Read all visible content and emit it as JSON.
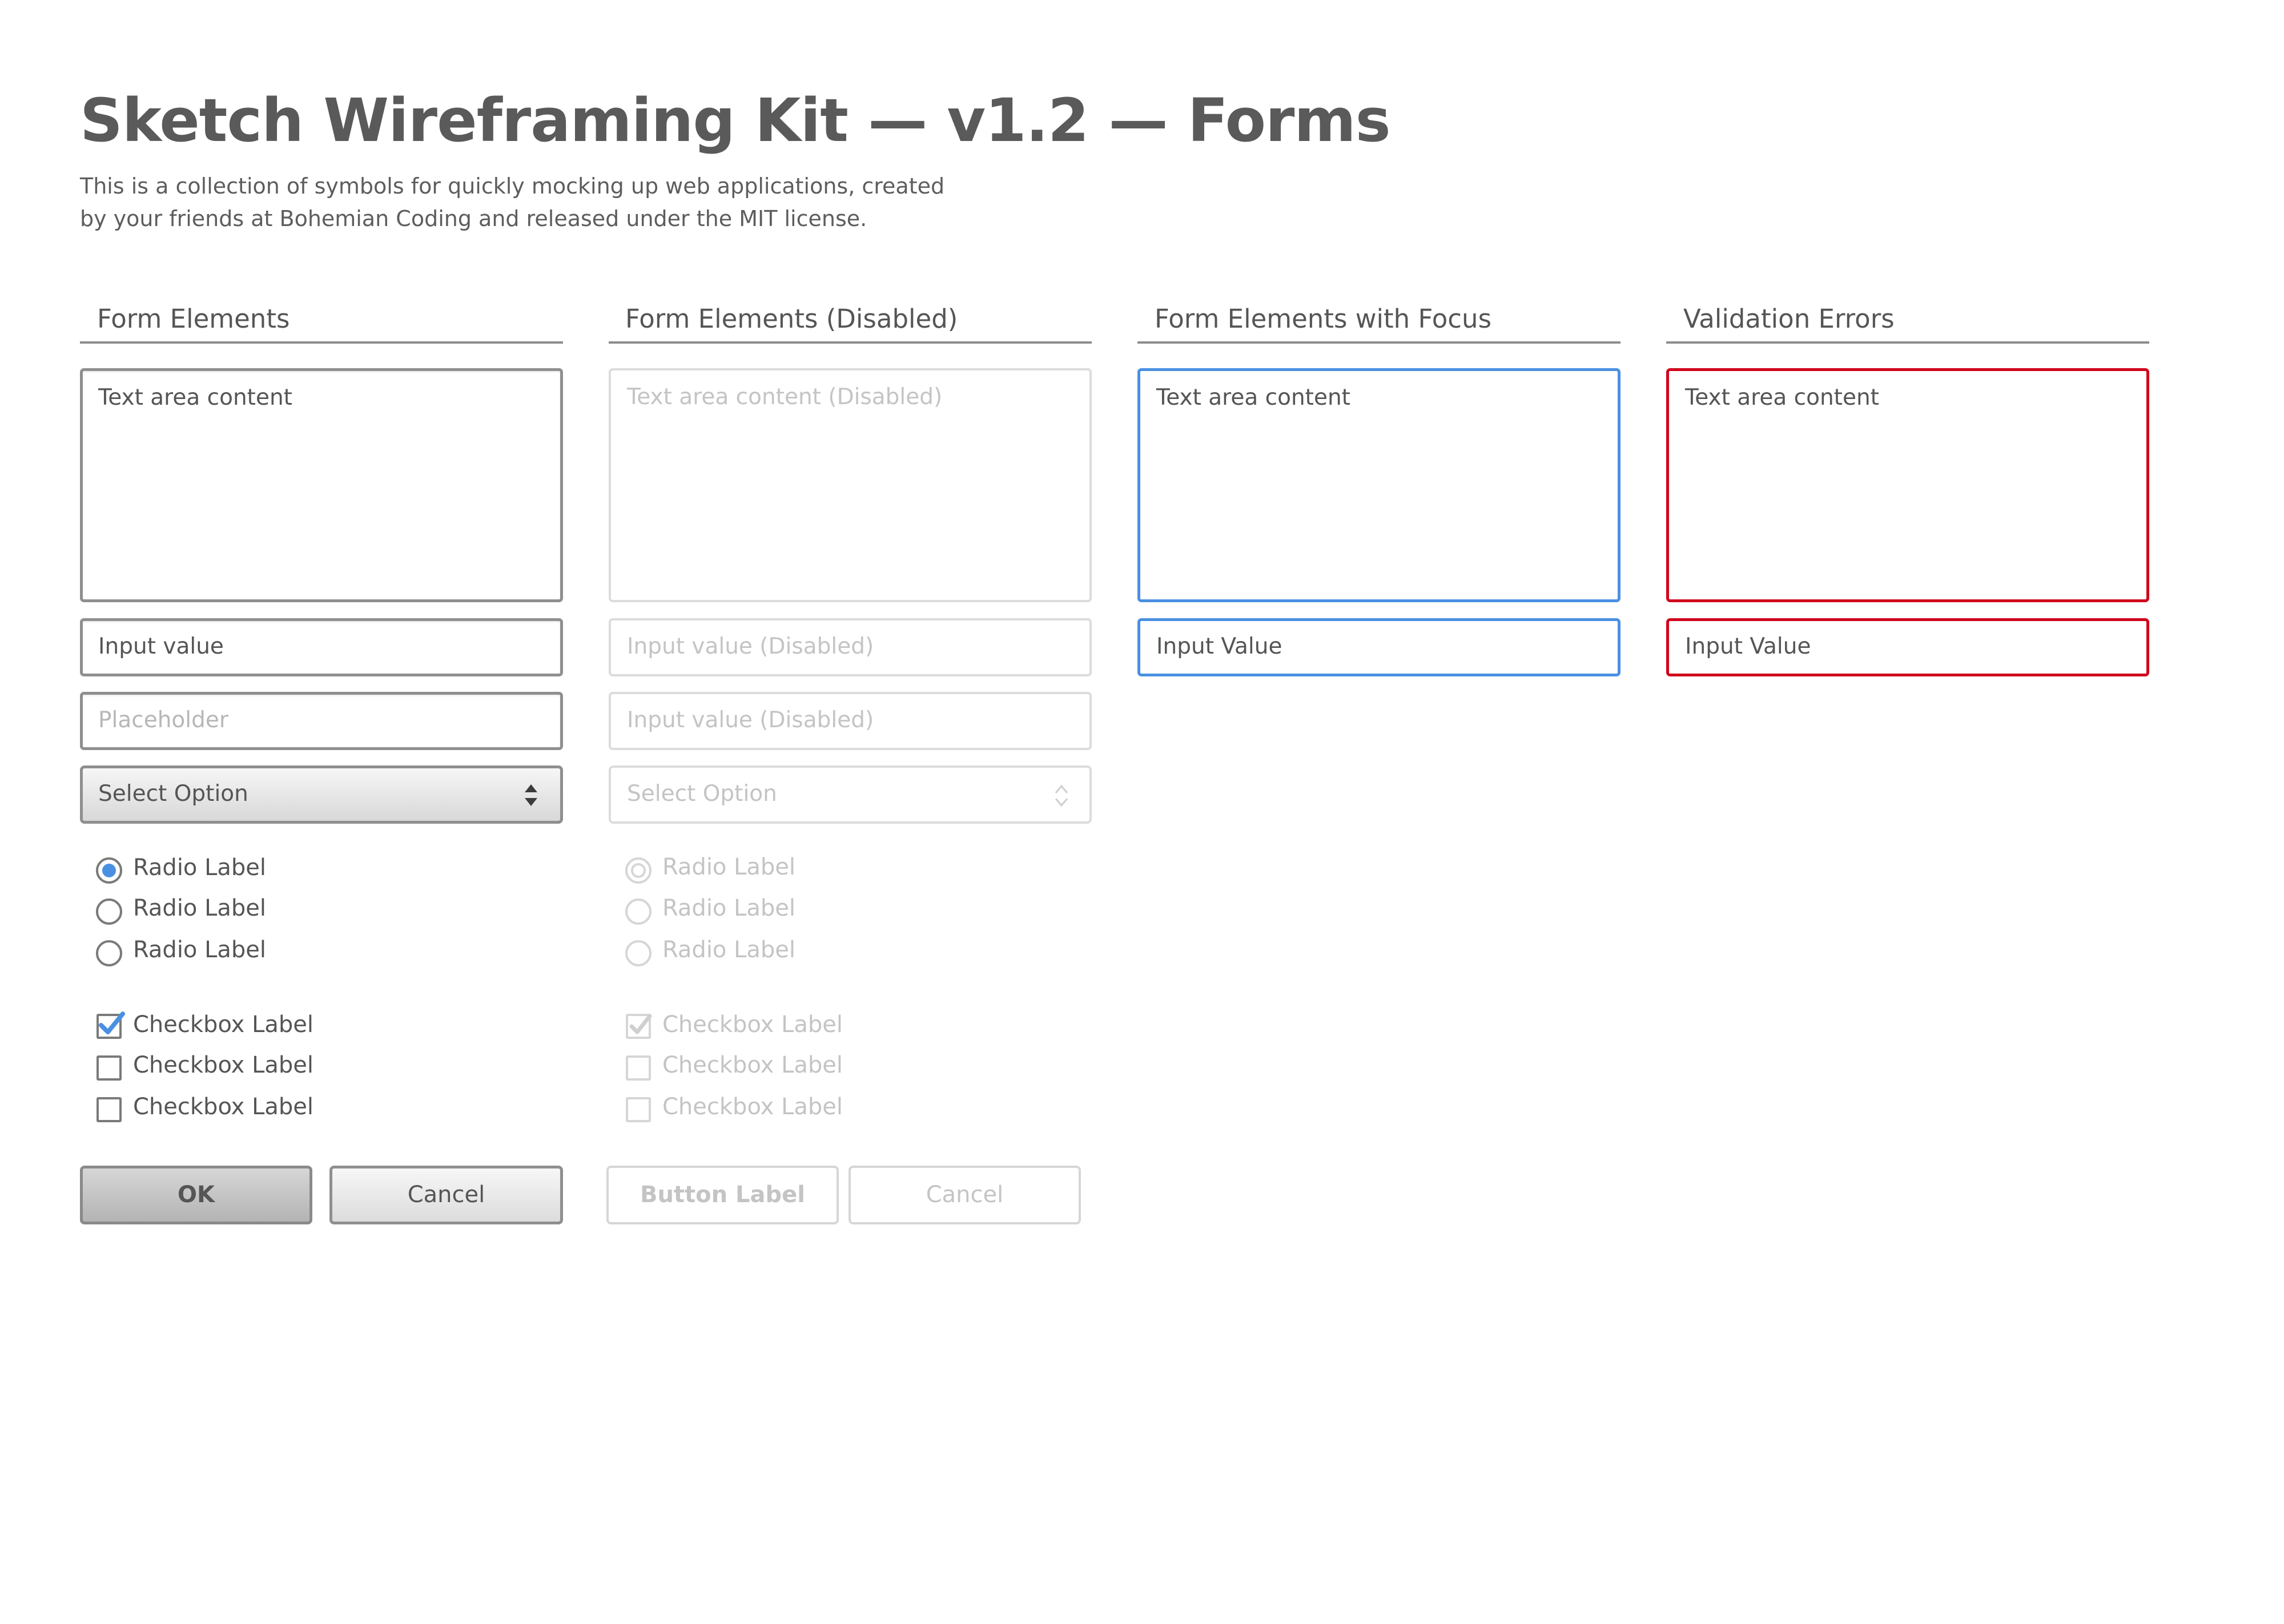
{
  "page": {
    "title": "Sketch Wireframing Kit — v1.2 — Forms",
    "description": "This is a collection of symbols for quickly mocking up web applications, created by your friends at Bohemian Coding and released under the MIT license."
  },
  "colors": {
    "text": "#555555",
    "border": "#8f8f8f",
    "disabled": "#c4c4c4",
    "focus": "#4a90e2",
    "error": "#d0021b"
  },
  "sections": {
    "normal": {
      "title": "Form Elements",
      "textarea": "Text area content",
      "input_value": "Input value",
      "input_placeholder": "Placeholder",
      "select_value": "Select Option",
      "radios": [
        {
          "label": "Radio Label",
          "checked": true
        },
        {
          "label": "Radio Label",
          "checked": false
        },
        {
          "label": "Radio Label",
          "checked": false
        }
      ],
      "checkboxes": [
        {
          "label": "Checkbox Label",
          "checked": true
        },
        {
          "label": "Checkbox Label",
          "checked": false
        },
        {
          "label": "Checkbox Label",
          "checked": false
        }
      ],
      "buttons": {
        "ok": "OK",
        "cancel": "Cancel"
      }
    },
    "disabled": {
      "title": "Form Elements (Disabled)",
      "textarea": "Text area content (Disabled)",
      "input_value_1": "Input value (Disabled)",
      "input_value_2": "Input value (Disabled)",
      "select_value": "Select Option",
      "radios": [
        {
          "label": "Radio Label",
          "checked": true
        },
        {
          "label": "Radio Label",
          "checked": false
        },
        {
          "label": "Radio Label",
          "checked": false
        }
      ],
      "checkboxes": [
        {
          "label": "Checkbox Label",
          "checked": true
        },
        {
          "label": "Checkbox Label",
          "checked": false
        },
        {
          "label": "Checkbox Label",
          "checked": false
        }
      ],
      "buttons": {
        "primary": "Button Label",
        "cancel": "Cancel"
      }
    },
    "focus": {
      "title": "Form Elements with Focus",
      "textarea": "Text area content",
      "input_value": "Input Value"
    },
    "errors": {
      "title": "Validation Errors",
      "textarea": "Text area content",
      "input_value": "Input Value"
    }
  }
}
